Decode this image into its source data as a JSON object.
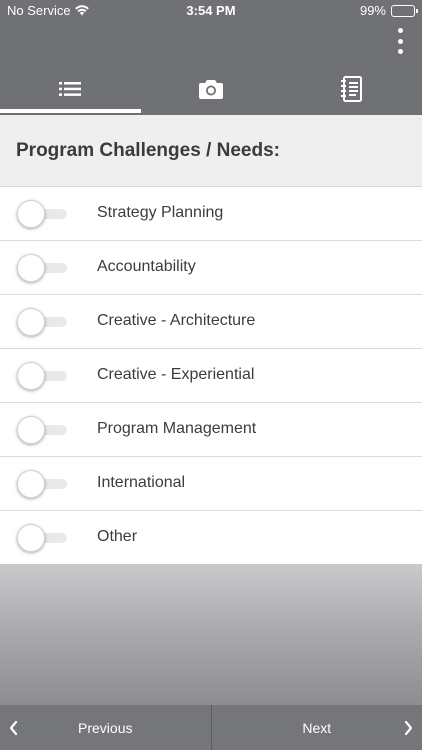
{
  "status_bar": {
    "carrier": "No Service",
    "time": "3:54 PM",
    "battery": "99%"
  },
  "icons": {
    "more": "more-vertical-icon",
    "tab_list": "list-icon",
    "tab_camera": "camera-icon",
    "tab_notes": "notebook-icon",
    "prev": "chevron-left-icon",
    "next": "chevron-right-icon"
  },
  "colors": {
    "header": "#707175",
    "active_tab_indicator": "#ffffff",
    "section_bg": "#efeff0",
    "bottom_nav": "#757679"
  },
  "section": {
    "title": "Program Challenges / Needs:"
  },
  "options": [
    {
      "label": "Strategy Planning",
      "on": false
    },
    {
      "label": "Accountability",
      "on": false
    },
    {
      "label": "Creative - Architecture",
      "on": false
    },
    {
      "label": "Creative - Experiential",
      "on": false
    },
    {
      "label": "Program Management",
      "on": false
    },
    {
      "label": "International",
      "on": false
    },
    {
      "label": "Other",
      "on": false
    }
  ],
  "nav": {
    "previous": "Previous",
    "next": "Next"
  }
}
